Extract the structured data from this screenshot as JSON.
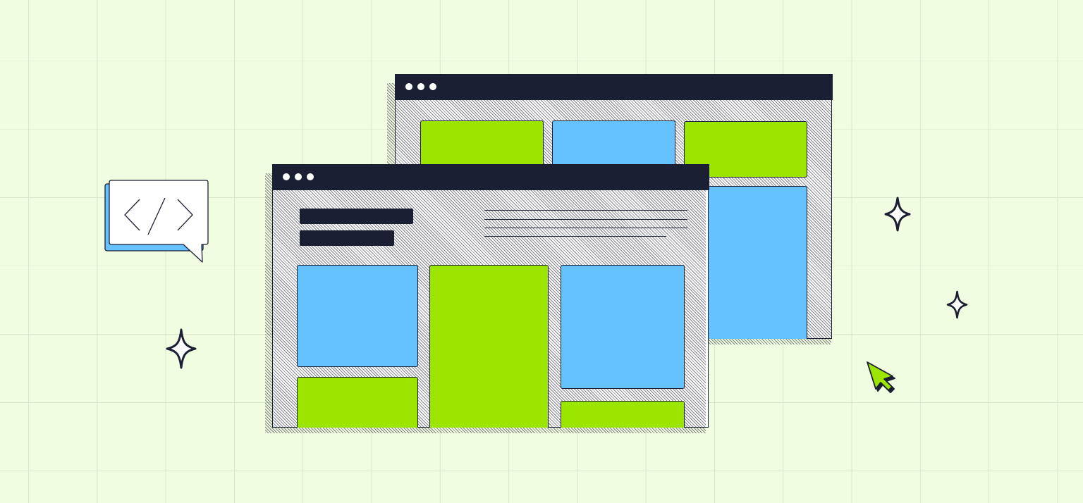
{
  "scene": {
    "background_color": "#f1fde0",
    "grid_color": "#d9e6cb"
  },
  "palette": {
    "dark": "#1b1f33",
    "green": "#9be500",
    "blue": "#66c1ff",
    "white": "#ffffff"
  },
  "windows": {
    "back": {
      "titlebar_dots": 3,
      "tiles": [
        "green",
        "blue",
        "green",
        "blue"
      ]
    },
    "front": {
      "titlebar_dots": 3,
      "header": {
        "title_bars": 2,
        "text_lines": 4
      },
      "tiles": [
        "blue",
        "green",
        "green",
        "blue",
        "green"
      ]
    }
  },
  "decorations": {
    "code_bubble": {
      "icon": "code-brackets-icon",
      "glyph": "</>"
    },
    "sparkles": [
      "sparkle-icon",
      "sparkle-icon",
      "sparkle-icon"
    ],
    "cursor": {
      "icon": "cursor-arrow-icon",
      "color": "#9be500"
    }
  }
}
